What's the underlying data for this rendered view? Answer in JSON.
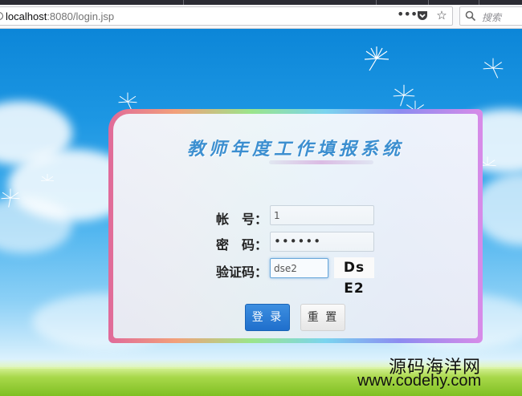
{
  "browser": {
    "url_host": "localhost",
    "url_rest": ":8080/login.jsp",
    "search_placeholder": "搜索"
  },
  "login": {
    "title": "教师年度工作填报系统",
    "account_label": "帐　号：",
    "account_value": "1",
    "password_label": "密　码：",
    "password_value": "••••••",
    "captcha_label": "验证码：",
    "captcha_value": "dse2",
    "captcha_image_text": "Ds E2",
    "login_button": "登 录",
    "reset_button": "重 置"
  },
  "watermark": {
    "cn": "源码海洋网",
    "en": "www.codehy.com"
  },
  "colors": {
    "sky": "#1d97e3",
    "title": "#3c8fd0",
    "primary_button": "#1f6fcc"
  }
}
